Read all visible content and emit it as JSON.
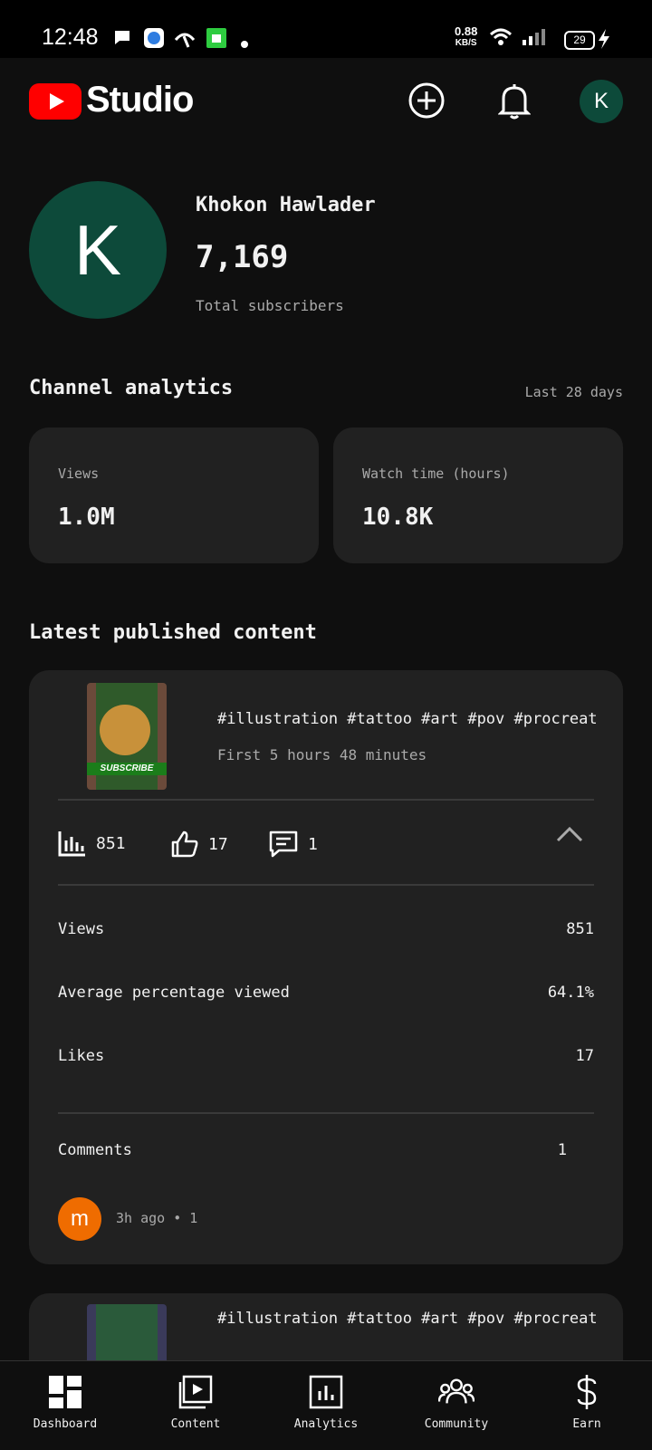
{
  "status_bar": {
    "time": "12:48",
    "speed_value": "0.88",
    "speed_unit": "KB/S",
    "battery": "29"
  },
  "appbar": {
    "title": "Studio",
    "avatar_letter": "K",
    "icons": [
      "create-icon",
      "bell-icon"
    ]
  },
  "channel": {
    "avatar_letter": "K",
    "name": "Khokon Hawlader",
    "subscribers": "7,169",
    "subscribers_label": "Total subscribers"
  },
  "analytics": {
    "title": "Channel analytics",
    "period": "Last 28 days",
    "cards": [
      {
        "label": "Views",
        "value": "1.0M"
      },
      {
        "label": "Watch time (hours)",
        "value": "10.8K"
      }
    ]
  },
  "latest": {
    "title": "Latest published content",
    "video": {
      "thumb_text": "SUBSCRIBE",
      "title": "#illustration #tattoo #art #pov #procreate...",
      "subtitle": "First 5 hours 48 minutes",
      "views": "851",
      "likes": "17",
      "comments": "1",
      "rows": [
        {
          "label": "Views",
          "value": "851"
        },
        {
          "label": "Average percentage viewed",
          "value": "64.1%"
        },
        {
          "label": "Likes",
          "value": "17"
        }
      ],
      "comments_label": "Comments",
      "comments_value": "1",
      "commenter_letter": "m",
      "comment_meta": "3h ago • 1"
    },
    "video2": {
      "title": "#illustration #tattoo #art #pov #procreate..."
    }
  },
  "bottom_nav": [
    {
      "label": "Dashboard",
      "icon": "dashboard-icon"
    },
    {
      "label": "Content",
      "icon": "content-icon"
    },
    {
      "label": "Analytics",
      "icon": "analytics-icon"
    },
    {
      "label": "Community",
      "icon": "community-icon"
    },
    {
      "label": "Earn",
      "icon": "earn-icon"
    }
  ],
  "colors": {
    "background": "#0f0f0f",
    "card": "#212121",
    "accent_red": "#ff0000",
    "avatar_green": "#0d4a3a",
    "commenter_orange": "#ef6c00"
  }
}
